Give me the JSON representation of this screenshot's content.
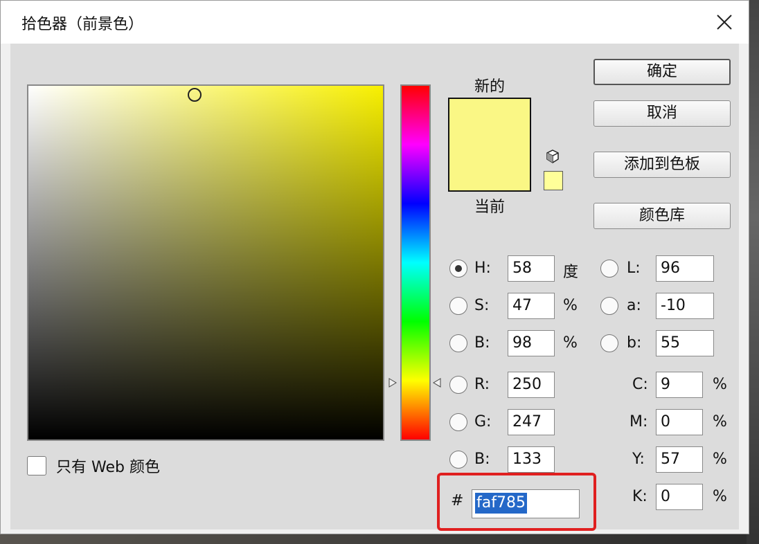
{
  "window": {
    "title": "拾色器（前景色）"
  },
  "field": {
    "web_only_label": "只有 Web 颜色"
  },
  "swatch": {
    "new_label": "新的",
    "current_label": "当前",
    "new_color": "#faf785",
    "current_color": "#faf785"
  },
  "buttons": {
    "ok": "确定",
    "cancel": "取消",
    "add_swatch": "添加到色板",
    "libraries": "颜色库"
  },
  "hsb": {
    "h": {
      "label": "H:",
      "value": "58",
      "unit": "度"
    },
    "s": {
      "label": "S:",
      "value": "47",
      "unit": "%"
    },
    "b": {
      "label": "B:",
      "value": "98",
      "unit": "%"
    }
  },
  "lab": {
    "l": {
      "label": "L:",
      "value": "96"
    },
    "a": {
      "label": "a:",
      "value": "-10"
    },
    "b": {
      "label": "b:",
      "value": "55"
    }
  },
  "rgb": {
    "r": {
      "label": "R:",
      "value": "250"
    },
    "g": {
      "label": "G:",
      "value": "247"
    },
    "b": {
      "label": "B:",
      "value": "133"
    }
  },
  "cmyk": {
    "c": {
      "label": "C:",
      "value": "9",
      "unit": "%"
    },
    "m": {
      "label": "M:",
      "value": "0",
      "unit": "%"
    },
    "y": {
      "label": "Y:",
      "value": "57",
      "unit": "%"
    },
    "k": {
      "label": "K:",
      "value": "0",
      "unit": "%"
    }
  },
  "hex": {
    "hash": "#",
    "value": "faf785"
  },
  "colors": {
    "highlight": "#e02020",
    "selection": "#2468c8"
  }
}
